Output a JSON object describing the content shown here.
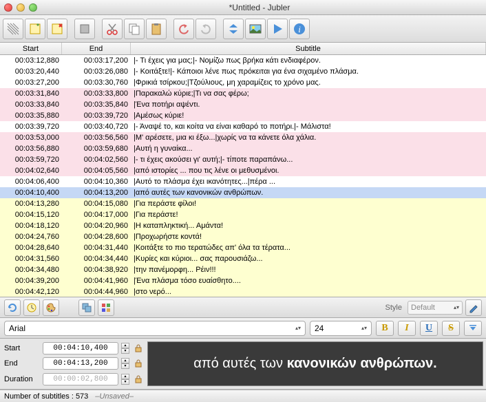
{
  "window": {
    "title": "*Untitled - Jubler"
  },
  "table": {
    "headers": {
      "start": "Start",
      "end": "End",
      "subtitle": "Subtitle"
    },
    "rows": [
      {
        "start": "00:03:12,880",
        "end": "00:03:17,200",
        "text": "|- Τι έχεις για μας;|- Νομίζω πως βρήκα κάτι ενδιαφέρον.",
        "color": "white"
      },
      {
        "start": "00:03:20,440",
        "end": "00:03:26,080",
        "text": "|- Κοιτάξτε!|- Κάποιοι λένε πως πρόκειται για ένα σιχαμένο πλάσμα.",
        "color": "white"
      },
      {
        "start": "00:03:27,200",
        "end": "00:03:30,760",
        "text": "|Φρικιά τσίρκου;|Τζούλιους, μη χαραμίζεις το χρόνο μας.",
        "color": "white"
      },
      {
        "start": "00:03:31,840",
        "end": "00:03:33,800",
        "text": "|Παρακαλώ κύριε;|Τι να σας φέρω;",
        "color": "pink"
      },
      {
        "start": "00:03:33,840",
        "end": "00:03:35,840",
        "text": "|Ένα ποτήρι αψέντι.",
        "color": "pink"
      },
      {
        "start": "00:03:35,880",
        "end": "00:03:39,720",
        "text": "|Αμέσως κύριε!",
        "color": "pink"
      },
      {
        "start": "00:03:39,720",
        "end": "00:03:40,720",
        "text": "|- Άναψέ το, και κοίτα να είναι καθαρό το ποτήρι.|- Μάλιστα!",
        "color": "white"
      },
      {
        "start": "00:03:53,000",
        "end": "00:03:56,560",
        "text": "|Μ' αρέσετε, μια κι έξω...|χωρίς να τα κάνετε όλα χάλια.",
        "color": "pink"
      },
      {
        "start": "00:03:56,880",
        "end": "00:03:59,680",
        "text": "|Αυτή η γυναίκα...",
        "color": "pink"
      },
      {
        "start": "00:03:59,720",
        "end": "00:04:02,560",
        "text": "|- τι έχεις ακούσει γι' αυτή;|- τίποτε παραπάνω...",
        "color": "pink"
      },
      {
        "start": "00:04:02,640",
        "end": "00:04:05,560",
        "text": "|από ιστορίες ... που τις λένε οι μεθυσμένοι.",
        "color": "pink"
      },
      {
        "start": "00:04:06,400",
        "end": "00:04:10,360",
        "text": "|Αυτό το πλάσμα έχει ικανότητες...|πέρα ...",
        "color": "white"
      },
      {
        "start": "00:04:10,400",
        "end": "00:04:13,200",
        "text": "|από αυτές των κανονικών ανθρώπων.",
        "color": "blue"
      },
      {
        "start": "00:04:13,280",
        "end": "00:04:15,080",
        "text": "|Για περάστε φίλοι!",
        "color": "yellow"
      },
      {
        "start": "00:04:15,120",
        "end": "00:04:17,000",
        "text": "|Για περάστε!",
        "color": "yellow"
      },
      {
        "start": "00:04:18,120",
        "end": "00:04:20,960",
        "text": "|Η καταπληκτική... Αμάντα!",
        "color": "yellow"
      },
      {
        "start": "00:04:24,760",
        "end": "00:04:28,600",
        "text": "|Προχωρήστε κοντά!",
        "color": "yellow"
      },
      {
        "start": "00:04:28,640",
        "end": "00:04:31,440",
        "text": "|Κοιτάξτε το πιο τερατώδες απ' όλα τα τέρατα...",
        "color": "yellow"
      },
      {
        "start": "00:04:31,560",
        "end": "00:04:34,440",
        "text": "|Κυρίες και κύριοι... σας παρουσιάζω...",
        "color": "yellow"
      },
      {
        "start": "00:04:34,480",
        "end": "00:04:38,920",
        "text": "|την πανέμορφη... Ρέιν!!!",
        "color": "yellow"
      },
      {
        "start": "00:04:39,200",
        "end": "00:04:41,960",
        "text": "|Ένα πλάσμα τόσο ευαίσθητο....",
        "color": "yellow"
      },
      {
        "start": "00:04:42,120",
        "end": "00:04:44,960",
        "text": "|στο νερό...",
        "color": "yellow"
      }
    ]
  },
  "style": {
    "label": "Style",
    "value": "Default"
  },
  "font": {
    "family": "Arial",
    "size": "24"
  },
  "edit": {
    "start_label": "Start",
    "start_value": "00:04:10,400",
    "end_label": "End",
    "end_value": "00:04:13,200",
    "dur_label": "Duration",
    "dur_value": "00:00:02,800",
    "preview_pre": "από αυτές των ",
    "preview_bold": "κανονικών ανθρώπων."
  },
  "status": {
    "count_label": "Number of subtitles :",
    "count": "573",
    "saved": "–Unsaved–"
  }
}
